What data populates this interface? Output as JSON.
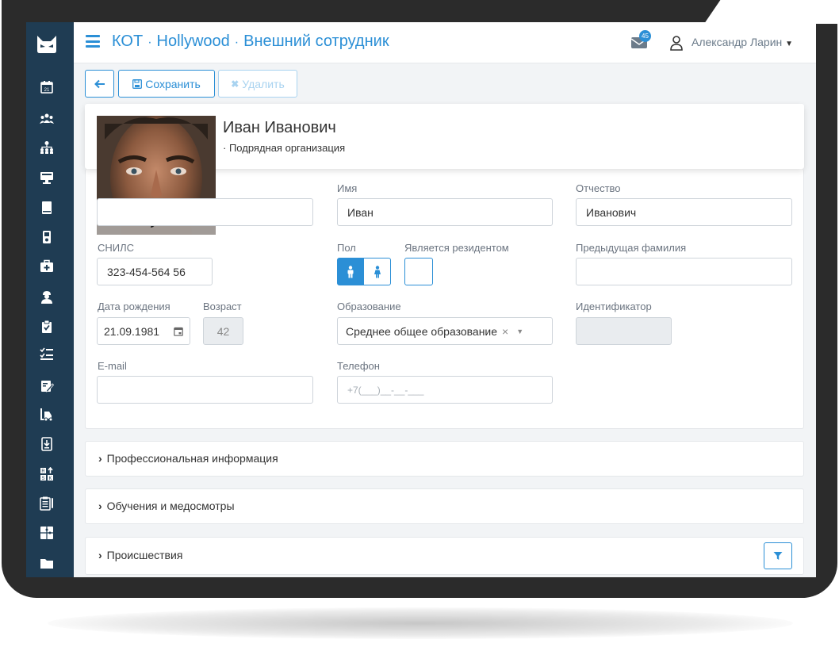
{
  "topbar": {
    "crumb1": "КОТ",
    "crumb2": "Hollywood",
    "crumb3": "Внешний сотрудник",
    "sep": "·",
    "mail_count": "45",
    "username": "Александр Ларин"
  },
  "toolbar": {
    "save_label": "Сохранить",
    "delete_label": "Удалить"
  },
  "person": {
    "name": "Иван Иванович",
    "subtitle": "· Подрядная организация"
  },
  "form": {
    "first_name_label": "Имя",
    "first_name_value": "Иван",
    "patronymic_label": "Отчество",
    "patronymic_value": "Иванович",
    "snils_label": "СНИЛС",
    "snils_value": "323-454-564 56",
    "gender_label": "Пол",
    "resident_label": "Является резидентом",
    "prev_surname_label": "Предыдущая фамилия",
    "birth_label": "Дата рождения",
    "birth_value": "21.09.1981",
    "age_label": "Возраст",
    "age_value": "42",
    "education_label": "Образование",
    "education_value": "Среднее общее образование",
    "identifier_label": "Идентификатор",
    "email_label": "E-mail",
    "phone_label": "Телефон",
    "phone_placeholder": "+7(___)__-__-___"
  },
  "sections": {
    "professional": "Профессиональная информация",
    "training": "Обучения и медосмотры",
    "incidents": "Происшествия"
  },
  "sidebar_icons": [
    "calendar-icon",
    "team-icon",
    "org-structure-icon",
    "monitor-icon",
    "book-icon",
    "device-icon",
    "first-aid-icon",
    "worker-icon",
    "clipboard-check-icon",
    "checklist-icon",
    "edit-doc-icon",
    "forklift-icon",
    "hand-doc-icon",
    "risk-icon",
    "reports-icon",
    "puzzle-icon",
    "folder-icon"
  ],
  "colors": {
    "accent": "#2b8fd6",
    "sidebar": "#1f3c53"
  }
}
